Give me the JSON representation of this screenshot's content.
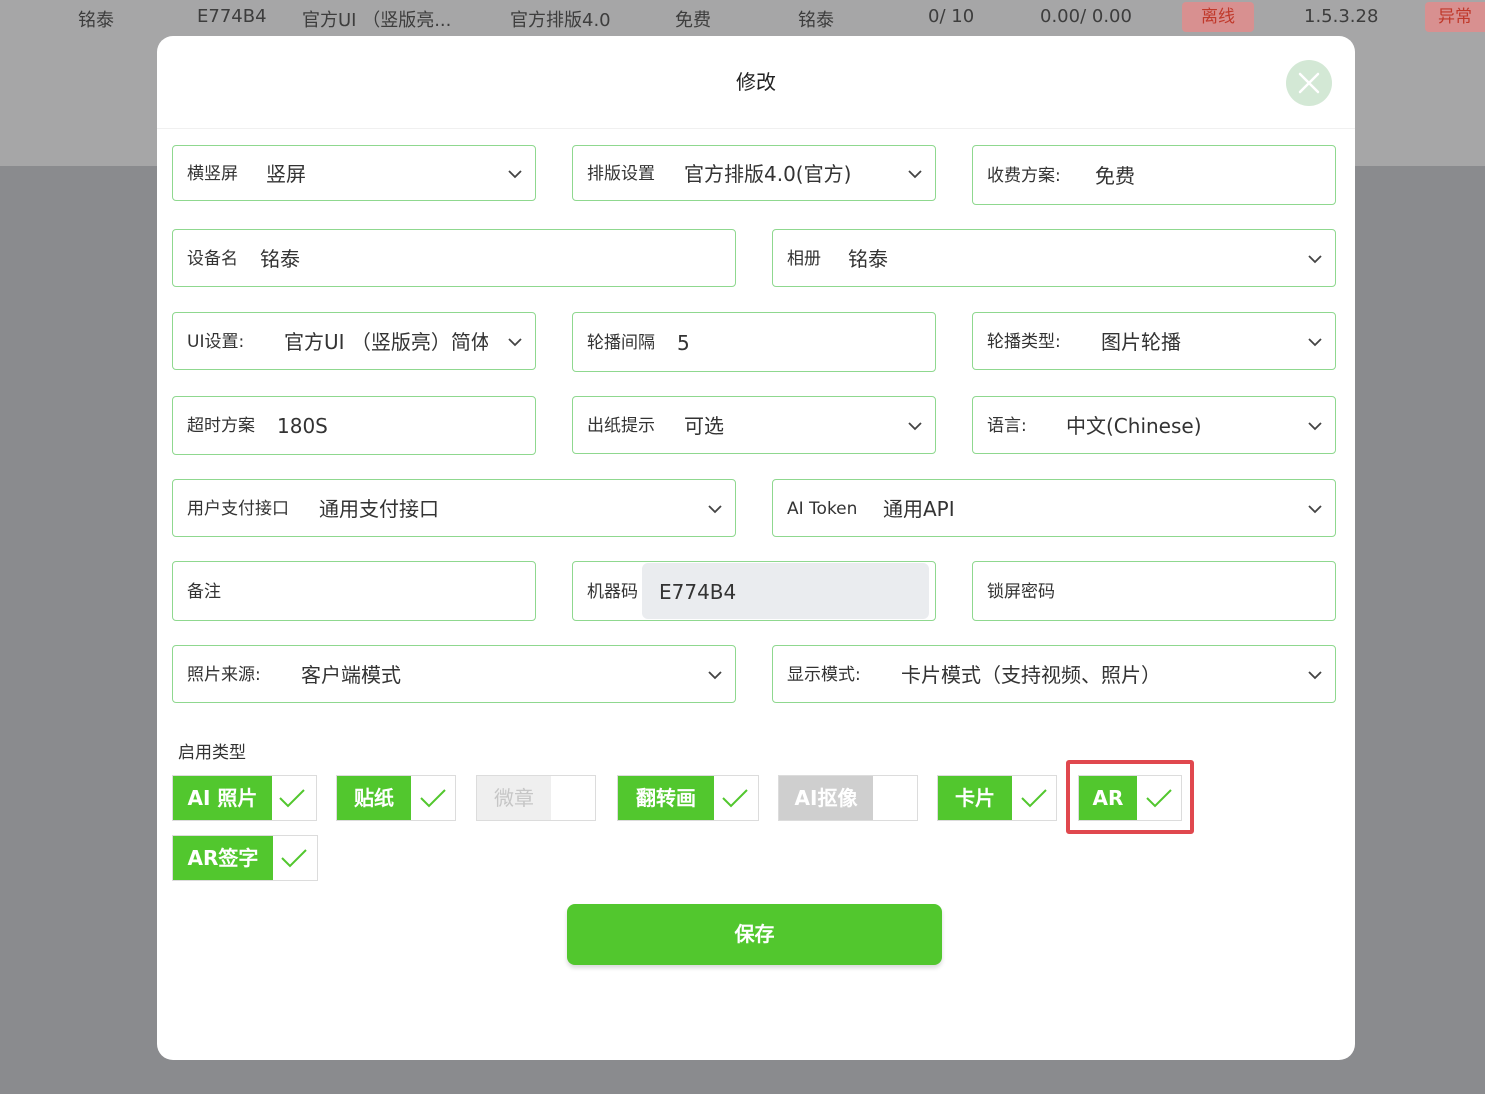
{
  "background_row": {
    "cells": [
      "铭泰",
      "E774B4",
      "官方UI （竖版亮...",
      "官方排版4.0",
      "免费",
      "铭泰",
      "0/ 10",
      "0.00/ 0.00",
      "1.5.3.28"
    ],
    "status_badge": "离线",
    "status_badge2": "异常"
  },
  "modal": {
    "title": "修改",
    "fields": {
      "orientation": {
        "label": "横竖屏",
        "value": "竖屏"
      },
      "layout": {
        "label": "排版设置",
        "value": "官方排版4.0(官方)"
      },
      "pricing": {
        "label": "收费方案:",
        "value": "免费"
      },
      "device_name": {
        "label": "设备名",
        "value": "铭泰"
      },
      "album": {
        "label": "相册",
        "value": "铭泰"
      },
      "ui_setting": {
        "label": "UI设置:",
        "value": "官方UI （竖版亮）简体"
      },
      "carousel_interval": {
        "label": "轮播间隔",
        "value": "5"
      },
      "carousel_type": {
        "label": "轮播类型:",
        "value": "图片轮播"
      },
      "timeout": {
        "label": "超时方案",
        "value": "180S"
      },
      "paper_hint": {
        "label": "出纸提示",
        "value": "可选"
      },
      "language": {
        "label": "语言:",
        "value": "中文(Chinese)"
      },
      "payment": {
        "label": "用户支付接口",
        "value": "通用支付接口"
      },
      "ai_token": {
        "label": "AI Token",
        "value": "通用API"
      },
      "remark": {
        "label": "备注",
        "value": ""
      },
      "machine_code": {
        "label": "机器码",
        "value": "E774B4"
      },
      "lock_password": {
        "label": "锁屏密码",
        "value": ""
      },
      "photo_source": {
        "label": "照片来源:",
        "value": "客户端模式"
      },
      "display_mode": {
        "label": "显示模式:",
        "value": "卡片模式（支持视频、照片）"
      }
    },
    "enabled_types_label": "启用类型",
    "enabled_types": [
      {
        "name": "AI 照片",
        "enabled": true
      },
      {
        "name": "贴纸",
        "enabled": true
      },
      {
        "name": "微章",
        "enabled": false
      },
      {
        "name": "翻转画",
        "enabled": true
      },
      {
        "name": "AI抠像",
        "enabled": false
      },
      {
        "name": "卡片",
        "enabled": true
      },
      {
        "name": "AR",
        "enabled": true
      },
      {
        "name": "AR签字",
        "enabled": true
      }
    ],
    "save_label": "保存"
  },
  "colors": {
    "accent": "#52c72e",
    "field_border": "#8fd88f",
    "highlight": "#e0484e"
  }
}
